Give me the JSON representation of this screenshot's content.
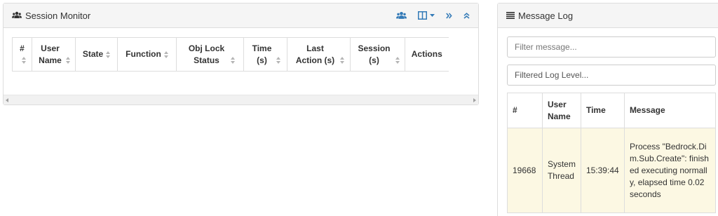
{
  "session_monitor": {
    "title": "Session Monitor",
    "columns": [
      {
        "label": "#",
        "sortable": true
      },
      {
        "label": "User Name",
        "sortable": true
      },
      {
        "label": "State",
        "sortable": true
      },
      {
        "label": "Function",
        "sortable": true
      },
      {
        "label": "Obj Lock Status",
        "sortable": true
      },
      {
        "label": "Time (s)",
        "sortable": true
      },
      {
        "label": "Last Action (s)",
        "sortable": true
      },
      {
        "label": "Session (s)",
        "sortable": true
      },
      {
        "label": "Actions",
        "sortable": false
      }
    ],
    "rows": [],
    "tool_icons": [
      "users-icon",
      "columns-icon",
      "caret-down-icon",
      "double-angle-right-icon",
      "double-angle-up-icon"
    ]
  },
  "message_log": {
    "title": "Message Log",
    "filter_placeholder": "Filter message...",
    "level_select": "Filtered Log Level...",
    "columns": [
      "#",
      "User Name",
      "Time",
      "Message"
    ],
    "rows": [
      {
        "id": "19668",
        "user": "System Thread",
        "time": "15:39:44",
        "message": "Process \"Bedrock.Dim.Sub.Create\": finished executing normally, elapsed time 0.02 seconds"
      }
    ]
  },
  "colors": {
    "accent": "#337ab7",
    "heading_bg": "#f5f5f5",
    "border": "#dddddd",
    "warning_row": "#fcf8e3"
  }
}
